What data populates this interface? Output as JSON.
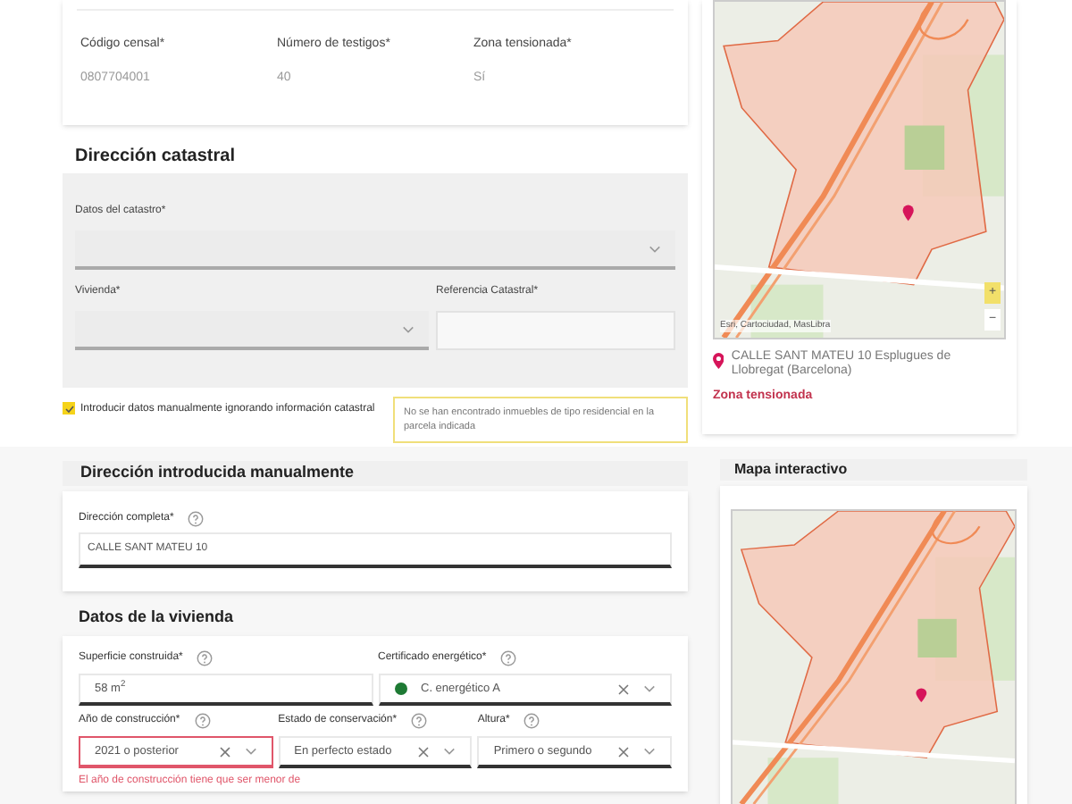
{
  "census": {
    "fields": [
      {
        "label": "Código censal*",
        "value": "0807704001"
      },
      {
        "label": "Número de testigos*",
        "value": "40"
      },
      {
        "label": "Zona tensionada*",
        "value": "Sí"
      }
    ]
  },
  "cadastral_address": {
    "title": "Dirección catastral",
    "fields": [
      {
        "label": "Datos del catastro*",
        "kind": "select"
      },
      {
        "label": "Vivienda*",
        "kind": "select"
      },
      {
        "label": "Referencia Catastral*",
        "kind": "input"
      }
    ]
  },
  "manual_checkbox": {
    "label": "Introducir datos manualmente ignorando información catastral",
    "checked": true
  },
  "warning": "No se han encontrado inmuebles de tipo residencial en la parcela indicada",
  "map_card": {
    "attribution": "Esri, Cartociudad, MasLibra",
    "zoom_in": "+",
    "zoom_out": "−",
    "address": "CALLE SANT MATEU 10 Esplugues de Llobregat (Barcelona)",
    "zone": "Zona tensionada"
  },
  "manual_address": {
    "title": "Dirección introducida manualmente",
    "field": {
      "label": "Dirección completa*",
      "value": "CALLE SANT MATEU 10"
    }
  },
  "dwelling": {
    "title": "Datos de la vivienda",
    "rows": [
      [
        {
          "label": "Superficie construida*",
          "value": "58 m$^{2}$",
          "kind": "input",
          "error": false
        },
        {
          "label": "Certificado energético*",
          "value": "C. energético A",
          "kind": "select",
          "color": "#1e7a34",
          "error": false
        }
      ],
      [
        {
          "label": "Año de construcción*",
          "value": "2021 o posterior",
          "kind": "select",
          "error": true
        },
        {
          "label": "Estado de conservación*",
          "value": "En perfecto estado",
          "kind": "select",
          "error": false
        },
        {
          "label": "Altura*",
          "value": "Primero o segundo",
          "kind": "select",
          "error": false
        }
      ]
    ],
    "error_message": "El año de construcción tiene que ser menor de"
  },
  "interactive_map": {
    "title": "Mapa interactivo"
  }
}
